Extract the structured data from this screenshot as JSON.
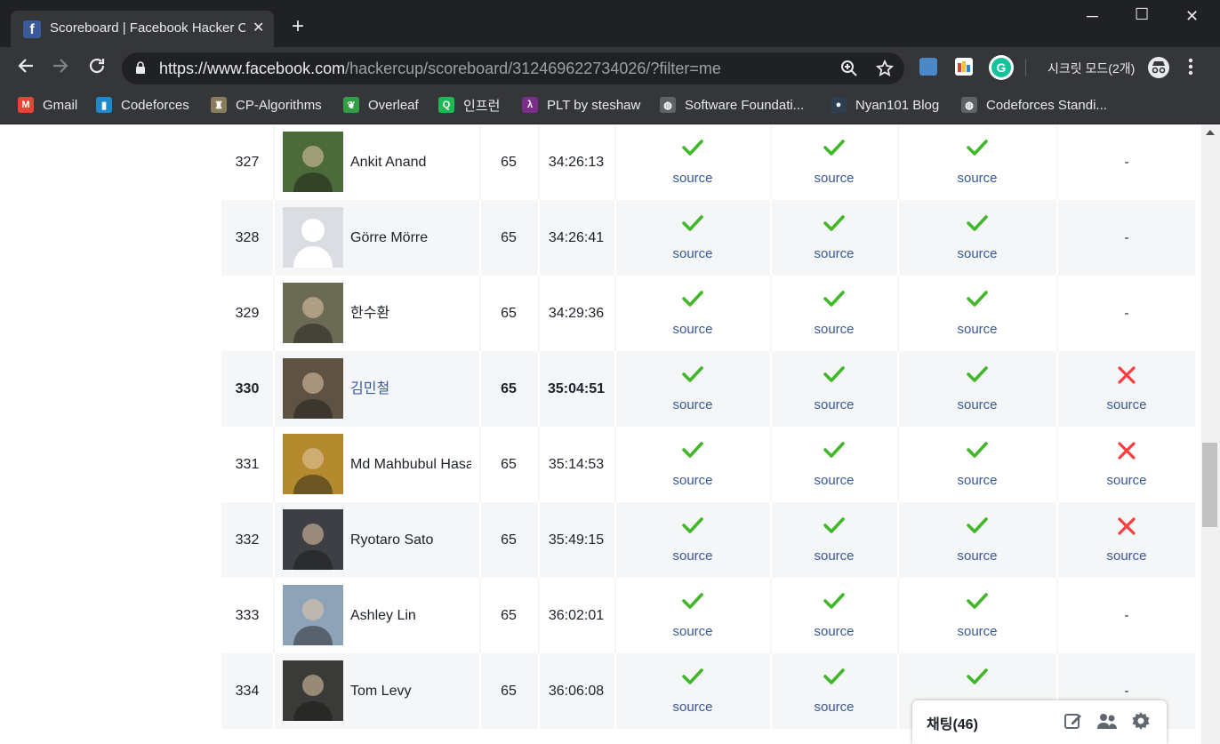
{
  "browser": {
    "tab_title": "Scoreboard | Facebook Hacker Cup",
    "favicon_letter": "f",
    "new_tab": "+",
    "url_host": "https://www.facebook.com",
    "url_path": "/hackercup/scoreboard/312469622734026/?filter=me",
    "incognito_label": "시크릿 모드(2개)",
    "window_controls": {
      "minimize": "─",
      "maximize": "☐",
      "close": "✕"
    }
  },
  "bookmarks": [
    {
      "label": "Gmail",
      "icon": "gmail-icon",
      "color": "#ea4335",
      "glyph": "M"
    },
    {
      "label": "Codeforces",
      "icon": "codeforces-icon",
      "color": "#1f8acb",
      "glyph": "▮"
    },
    {
      "label": "CP-Algorithms",
      "icon": "cp-algorithms-icon",
      "color": "#8a7b5a",
      "glyph": "♜"
    },
    {
      "label": "Overleaf",
      "icon": "overleaf-icon",
      "color": "#2f9e44",
      "glyph": "❦"
    },
    {
      "label": "인프런",
      "icon": "inflearn-icon",
      "color": "#1db954",
      "glyph": "Q"
    },
    {
      "label": "PLT by steshaw",
      "icon": "plt-icon",
      "color": "#7b2d8b",
      "glyph": "λ"
    },
    {
      "label": "Software Foundati...",
      "icon": "globe-icon",
      "color": "#5f6368",
      "glyph": "◍"
    },
    {
      "label": "Nyan101 Blog",
      "icon": "nyan-icon",
      "color": "#2c3e50",
      "glyph": "●"
    },
    {
      "label": "Codeforces Standi...",
      "icon": "globe-icon",
      "color": "#5f6368",
      "glyph": "◍"
    }
  ],
  "scoreboard": {
    "source_label": "source",
    "dash": "-",
    "rows": [
      {
        "rank": "327",
        "name": "Ankit Anand",
        "score": "65",
        "time": "34:26:13",
        "problems": [
          "ok",
          "ok",
          "ok",
          "none"
        ],
        "avatar_color": "#4d6b3a",
        "me": false
      },
      {
        "rank": "328",
        "name": "Görre Mörre",
        "score": "65",
        "time": "34:26:41",
        "problems": [
          "ok",
          "ok",
          "ok",
          "none"
        ],
        "avatar_color": "#dadde1",
        "me": false
      },
      {
        "rank": "329",
        "name": "한수환",
        "score": "65",
        "time": "34:29:36",
        "problems": [
          "ok",
          "ok",
          "ok",
          "none"
        ],
        "avatar_color": "#6b6a55",
        "me": false
      },
      {
        "rank": "330",
        "name": "김민철",
        "score": "65",
        "time": "35:04:51",
        "problems": [
          "ok",
          "ok",
          "ok",
          "fail"
        ],
        "avatar_color": "#5e5244",
        "me": true
      },
      {
        "rank": "331",
        "name": "Md Mahbubul Hasan",
        "score": "65",
        "time": "35:14:53",
        "problems": [
          "ok",
          "ok",
          "ok",
          "fail"
        ],
        "avatar_color": "#b38b2e",
        "me": false
      },
      {
        "rank": "332",
        "name": "Ryotaro Sato",
        "score": "65",
        "time": "35:49:15",
        "problems": [
          "ok",
          "ok",
          "ok",
          "fail"
        ],
        "avatar_color": "#3d3f45",
        "me": false
      },
      {
        "rank": "333",
        "name": "Ashley Lin",
        "score": "65",
        "time": "36:02:01",
        "problems": [
          "ok",
          "ok",
          "ok",
          "none"
        ],
        "avatar_color": "#8fa3b8",
        "me": false
      },
      {
        "rank": "334",
        "name": "Tom Levy",
        "score": "65",
        "time": "36:06:08",
        "problems": [
          "ok",
          "ok",
          "ok",
          "none"
        ],
        "avatar_color": "#3a3a38",
        "me": false
      }
    ]
  },
  "chat": {
    "title": "채팅(46)"
  },
  "colors": {
    "check": "#42b72a",
    "cross": "#fa3e3e",
    "link": "#385898",
    "alt_row": "#f5f6f7"
  }
}
